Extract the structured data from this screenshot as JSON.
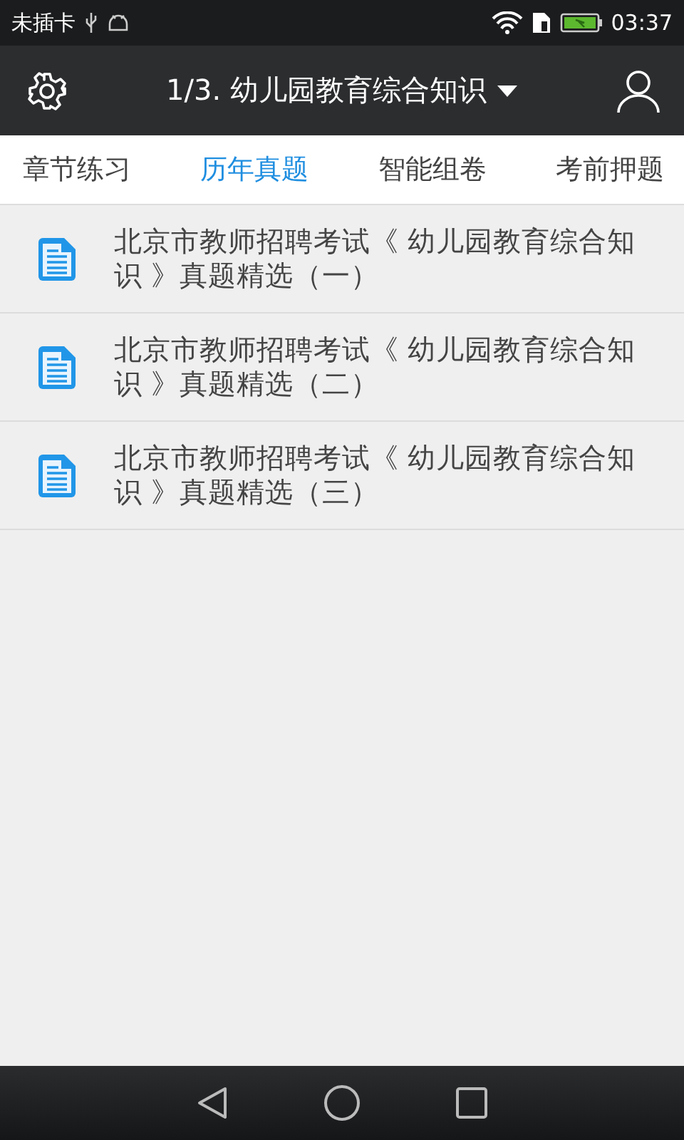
{
  "status_bar": {
    "carrier": "未插卡",
    "time": "03:37"
  },
  "app_bar": {
    "title": "1/3. 幼儿园教育综合知识"
  },
  "tabs": [
    {
      "label": "章节练习",
      "selected": false
    },
    {
      "label": "历年真题",
      "selected": true
    },
    {
      "label": "智能组卷",
      "selected": false
    },
    {
      "label": "考前押题",
      "selected": false
    }
  ],
  "items": [
    {
      "title": "北京市教师招聘考试《 幼儿园教育综合知识 》真题精选（一）"
    },
    {
      "title": "北京市教师招聘考试《 幼儿园教育综合知识 》真题精选（二）"
    },
    {
      "title": "北京市教师招聘考试《 幼儿园教育综合知识 》真题精选（三）"
    }
  ]
}
